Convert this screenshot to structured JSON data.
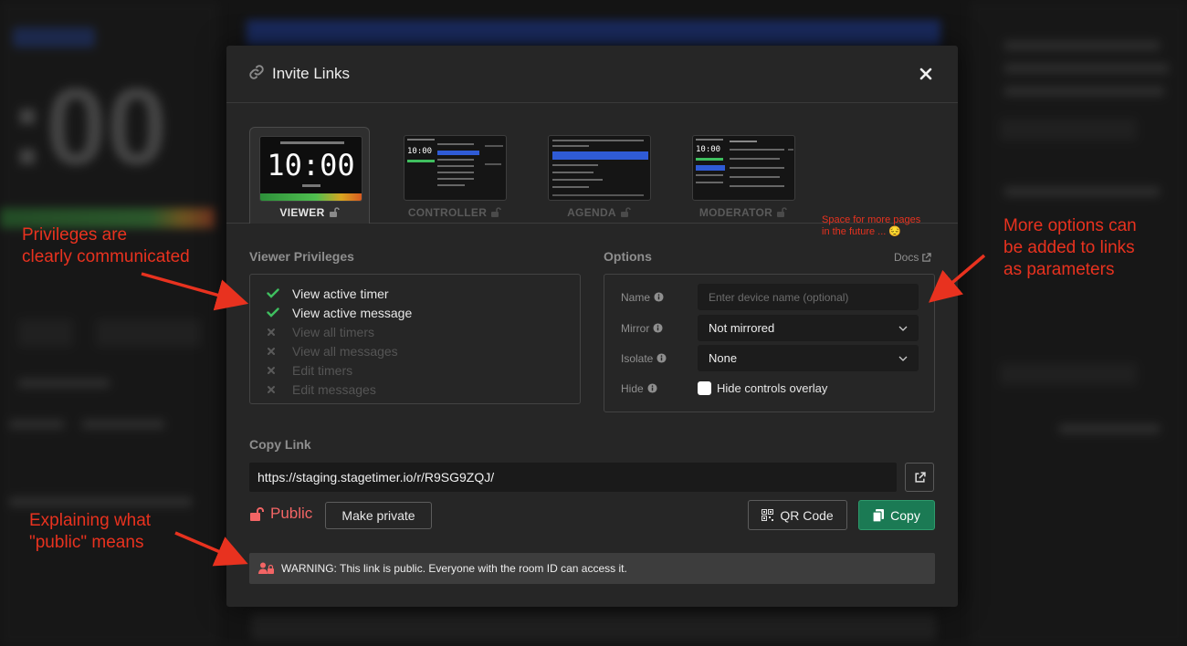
{
  "background": {
    "timer_text": ":00"
  },
  "annotations": {
    "privileges": [
      "Privileges are",
      "clearly communicated"
    ],
    "options": [
      "More options can",
      "be added to links",
      "as parameters"
    ],
    "public": [
      "Explaining what",
      "\"public\" means"
    ]
  },
  "modal": {
    "title": "Invite Links",
    "tabs": [
      {
        "label": "VIEWER",
        "active": true
      },
      {
        "label": "CONTROLLER",
        "active": false
      },
      {
        "label": "AGENDA",
        "active": false
      },
      {
        "label": "MODERATOR",
        "active": false
      }
    ],
    "viewer_thumb_time": "10:00",
    "controller_thumb_time": "10:00",
    "moderator_thumb_time": "10:00",
    "future_note": [
      "Space for more pages",
      "in the future ... 😔"
    ],
    "privileges": {
      "title": "Viewer Privileges",
      "items": [
        {
          "label": "View active timer",
          "enabled": true
        },
        {
          "label": "View active message",
          "enabled": true
        },
        {
          "label": "View all timers",
          "enabled": false
        },
        {
          "label": "View all messages",
          "enabled": false
        },
        {
          "label": "Edit timers",
          "enabled": false
        },
        {
          "label": "Edit messages",
          "enabled": false
        }
      ]
    },
    "options": {
      "title": "Options",
      "docs_label": "Docs",
      "name_label": "Name",
      "name_placeholder": "Enter device name (optional)",
      "mirror_label": "Mirror",
      "mirror_value": "Not mirrored",
      "isolate_label": "Isolate",
      "isolate_value": "None",
      "hide_label": "Hide",
      "hide_checkbox_label": "Hide controls overlay"
    },
    "copy_link": {
      "title": "Copy Link",
      "url": "https://staging.stagetimer.io/r/R9SG9ZQJ/",
      "public_label": "Public",
      "make_private_label": "Make private",
      "qr_label": "QR Code",
      "copy_label": "Copy"
    },
    "warning": "WARNING: This link is public. Everyone with the room ID can access it."
  },
  "colors": {
    "accent_red": "#e8321f",
    "public_red": "#f36565",
    "copy_green": "#1b7a54",
    "check_green": "#3fbf5f",
    "active_tab_blue": "#2f5bd6"
  }
}
